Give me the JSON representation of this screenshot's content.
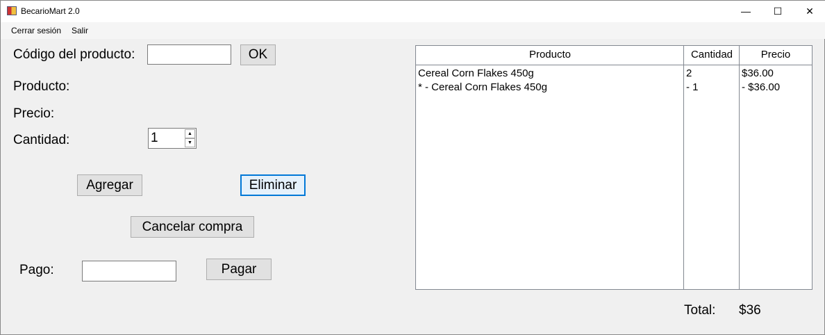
{
  "window": {
    "title": "BecarioMart 2.0",
    "minimize": "—",
    "maximize": "☐",
    "close": "✕"
  },
  "menu": [
    "Cerrar sesión",
    "Salir"
  ],
  "form": {
    "codigo_label": "Código del producto:",
    "codigo_value": "",
    "ok": "OK",
    "producto_label": "Producto:",
    "precio_label": "Precio:",
    "cantidad_label": "Cantidad:",
    "cantidad_value": "1",
    "agregar": "Agregar",
    "eliminar": "Eliminar",
    "cancelar": "Cancelar compra",
    "pago_label": "Pago:",
    "pago_value": "",
    "pagar": "Pagar"
  },
  "table": {
    "headers": [
      "Producto",
      "Cantidad",
      "Precio"
    ],
    "rows": [
      [
        "Cereal Corn Flakes 450g",
        "2",
        "$36.00"
      ],
      [
        "* - Cereal Corn Flakes 450g",
        "- 1",
        "- $36.00"
      ]
    ]
  },
  "total": {
    "label": "Total:",
    "value": "$36"
  }
}
